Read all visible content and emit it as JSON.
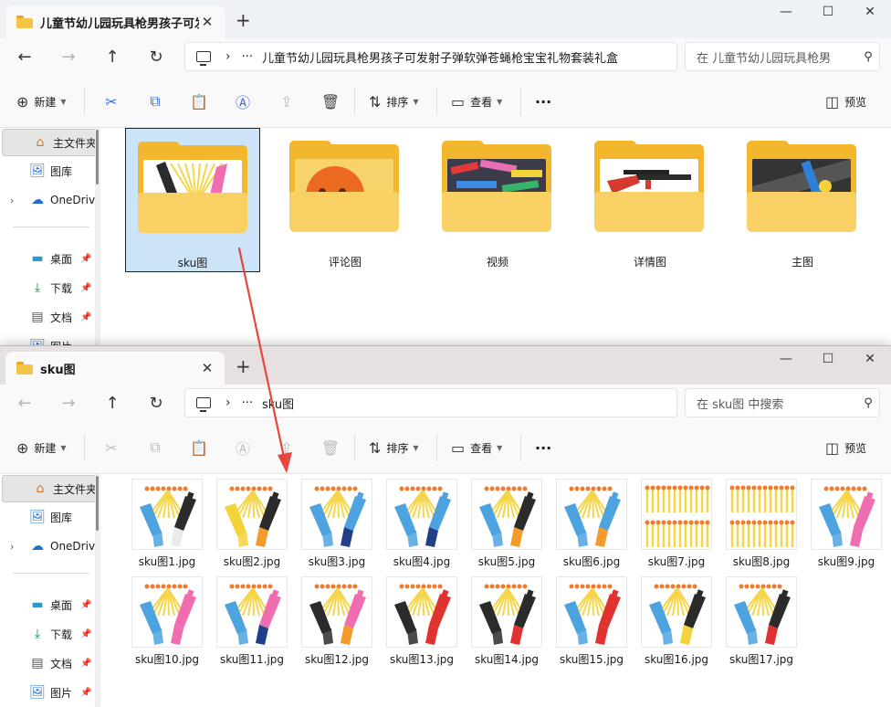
{
  "colors": {
    "accent": "#0067c0",
    "folder": "#f2b72c",
    "folder_front": "#f8d064",
    "selection": "#cce4f7",
    "arrow": "#e8463c"
  },
  "icons": {
    "window_minimize": "minimize-icon",
    "window_maximize": "maximize-icon",
    "window_close": "close-icon"
  },
  "window1": {
    "tab_title": "儿童节幼儿园玩具枪男孩子可发射子弹软弹苍蝇枪宝宝礼物套装礼盒",
    "address_path": "儿童节幼儿园玩具枪男孩子可发射子弹软弹苍蝇枪宝宝礼物套装礼盒",
    "search_placeholder": "在 儿童节幼儿园玩具枪男",
    "folders": [
      {
        "name": "sku图",
        "selected": true,
        "preview": "sku"
      },
      {
        "name": "评论图",
        "selected": false,
        "preview": "orange"
      },
      {
        "name": "视频",
        "selected": false,
        "preview": "toys"
      },
      {
        "name": "详情图",
        "selected": false,
        "preview": "rifle"
      },
      {
        "name": "主图",
        "selected": false,
        "preview": "dark"
      }
    ]
  },
  "window2": {
    "tab_title": "sku图",
    "address_path": "sku图",
    "search_placeholder": "在 sku图 中搜索",
    "files": [
      {
        "name": "sku图1.jpg",
        "left": "blue",
        "right": "black",
        "stock": "white"
      },
      {
        "name": "sku图2.jpg",
        "left": "yellow",
        "right": "black",
        "stock": "orange"
      },
      {
        "name": "sku图3.jpg",
        "left": "blue",
        "right": "blue",
        "stock": "navy"
      },
      {
        "name": "sku图4.jpg",
        "left": "blue",
        "right": "blue",
        "stock": "navy"
      },
      {
        "name": "sku图5.jpg",
        "left": "blue",
        "right": "black",
        "stock": "orange"
      },
      {
        "name": "sku图6.jpg",
        "left": "blue",
        "right": "blue",
        "stock": "orange"
      },
      {
        "name": "sku图7.jpg",
        "pattern": "darts"
      },
      {
        "name": "sku图8.jpg",
        "pattern": "darts"
      },
      {
        "name": "sku图9.jpg",
        "left": "blue",
        "right": "pink",
        "stock": "pink"
      },
      {
        "name": "sku图10.jpg",
        "left": "blue",
        "right": "pink",
        "stock": "pink"
      },
      {
        "name": "sku图11.jpg",
        "left": "blue",
        "right": "pink",
        "stock": "navy"
      },
      {
        "name": "sku图12.jpg",
        "left": "black",
        "right": "pink",
        "stock": "orange"
      },
      {
        "name": "sku图13.jpg",
        "left": "black",
        "right": "red",
        "stock": "red"
      },
      {
        "name": "sku图14.jpg",
        "left": "black",
        "right": "black",
        "stock": "red"
      },
      {
        "name": "sku图15.jpg",
        "left": "blue",
        "right": "red",
        "stock": "red"
      },
      {
        "name": "sku图16.jpg",
        "left": "blue",
        "right": "black",
        "stock": "yellow"
      },
      {
        "name": "sku图17.jpg",
        "left": "blue",
        "right": "black",
        "stock": "red"
      }
    ]
  },
  "toolbar": {
    "new_label": "新建",
    "sort_label": "排序",
    "view_label": "查看",
    "preview_label": "预览",
    "more_label": "···"
  },
  "sidebar": {
    "home": "主文件夹",
    "gallery": "图库",
    "onedrive": "OneDrive",
    "desktop": "桌面",
    "downloads": "下载",
    "documents": "文档",
    "pictures": "图片"
  }
}
